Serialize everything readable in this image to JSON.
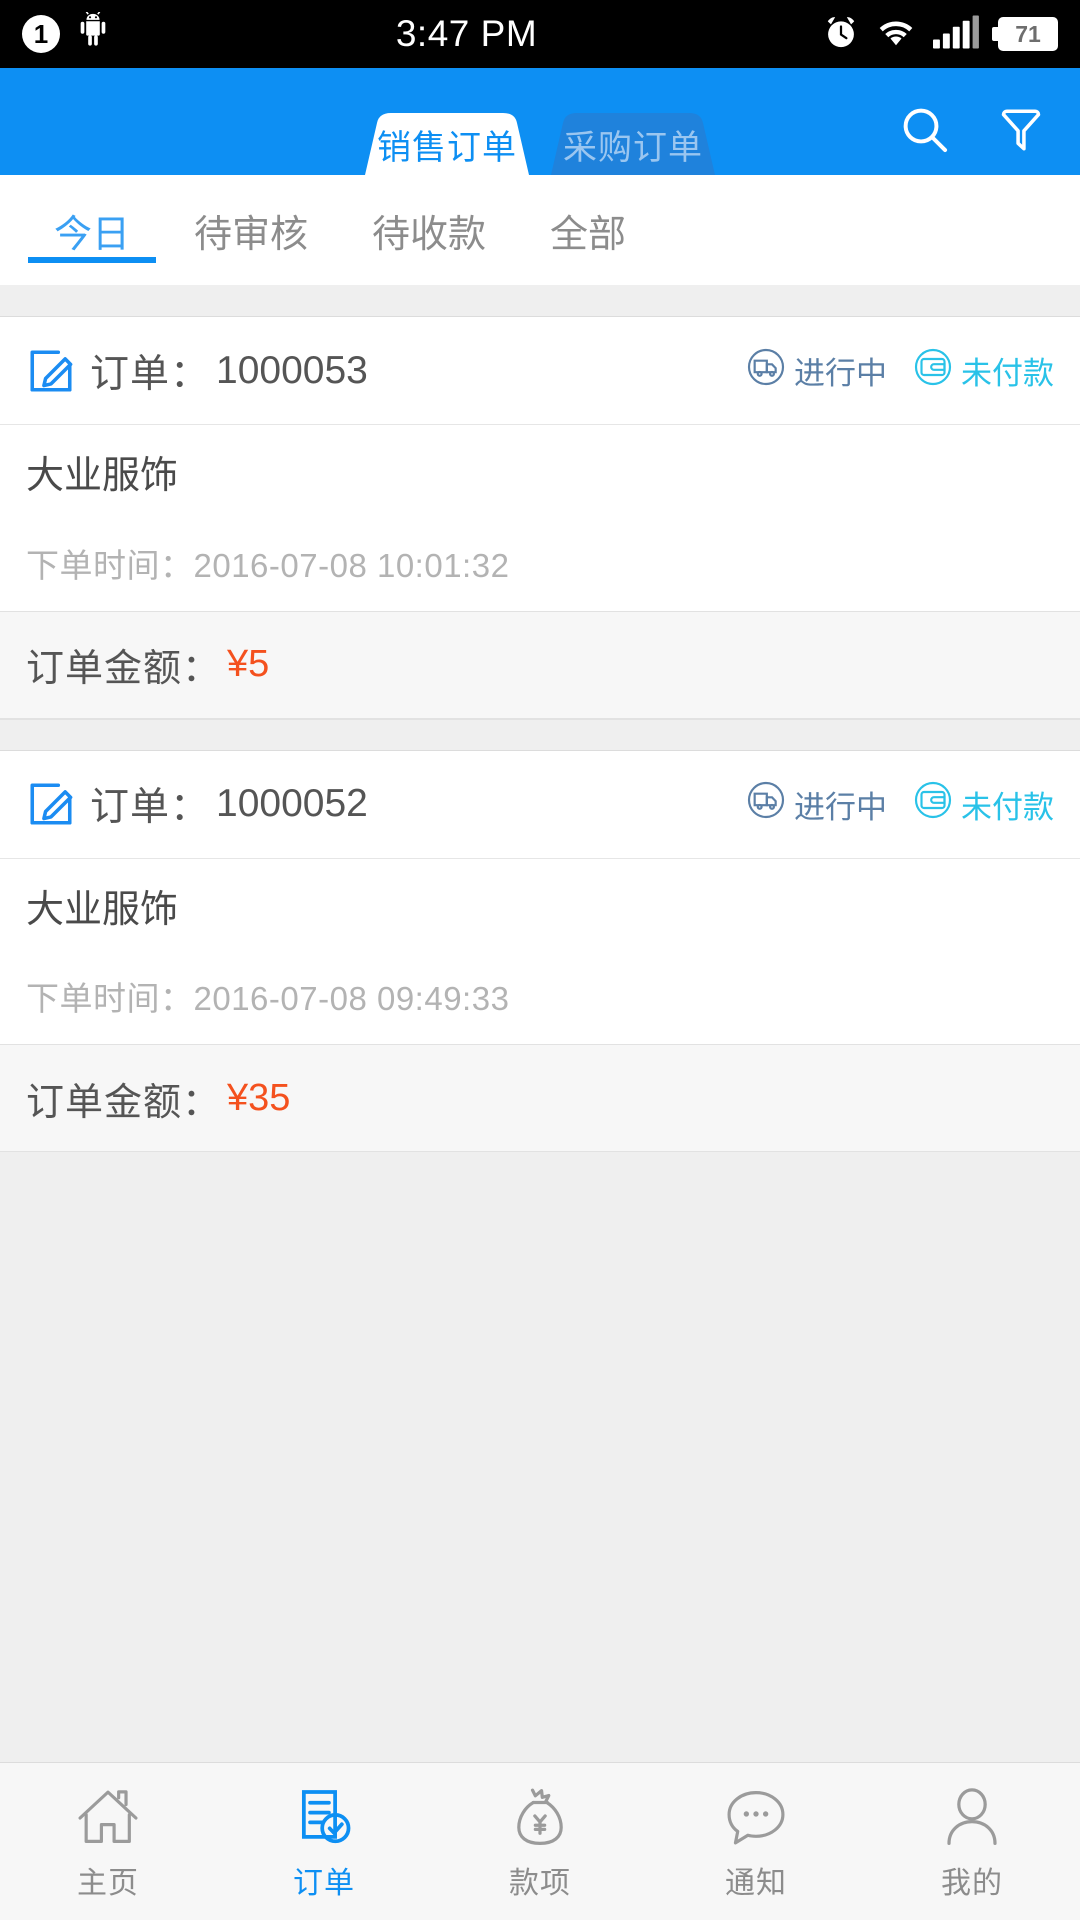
{
  "status_bar": {
    "notification_count": "1",
    "android_icon": "android-robot-icon",
    "time": "3:47 PM",
    "alarm_icon": "alarm-clock-icon",
    "wifi_icon": "wifi-icon",
    "signal_icon": "cellular-signal-icon",
    "battery_level": "71"
  },
  "header": {
    "accent_color": "#0d8ff3",
    "tabs": [
      {
        "label": "销售订单",
        "active": true
      },
      {
        "label": "采购订单",
        "active": false
      }
    ],
    "actions": [
      {
        "name": "search-icon",
        "label": "搜索"
      },
      {
        "name": "filter-icon",
        "label": "筛选"
      }
    ]
  },
  "sub_tabs": [
    {
      "label": "今日",
      "active": true
    },
    {
      "label": "待审核",
      "active": false
    },
    {
      "label": "待收款",
      "active": false
    },
    {
      "label": "全部",
      "active": false
    }
  ],
  "labels": {
    "order_prefix": "订单：",
    "order_time_prefix": "下单时间：",
    "amount_prefix": "订单金额：",
    "edit_icon": "edit-order-icon",
    "shipping_icon": "truck-in-circle-icon",
    "payment_icon": "wallet-in-circle-icon"
  },
  "colors": {
    "amount": "#f4511e",
    "shipping_status": "#5b7fa6",
    "payment_status": "#29c2e8",
    "active_tab": "#0d8ff3",
    "inactive_tab": "#9ac6f0"
  },
  "orders": [
    {
      "order_no": "1000053",
      "customer": "大业服饰",
      "order_time": "2016-07-08 10:01:32",
      "shipping_status": "进行中",
      "payment_status": "未付款",
      "amount": "¥5"
    },
    {
      "order_no": "1000052",
      "customer": "大业服饰",
      "order_time": "2016-07-08 09:49:33",
      "shipping_status": "进行中",
      "payment_status": "未付款",
      "amount": "¥35"
    }
  ],
  "bottom_nav": [
    {
      "label": "主页",
      "icon": "home-icon",
      "active": false
    },
    {
      "label": "订单",
      "icon": "order-doc-icon",
      "active": true
    },
    {
      "label": "款项",
      "icon": "money-bag-icon",
      "active": false
    },
    {
      "label": "通知",
      "icon": "chat-bubble-icon",
      "active": false
    },
    {
      "label": "我的",
      "icon": "person-icon",
      "active": false
    }
  ]
}
